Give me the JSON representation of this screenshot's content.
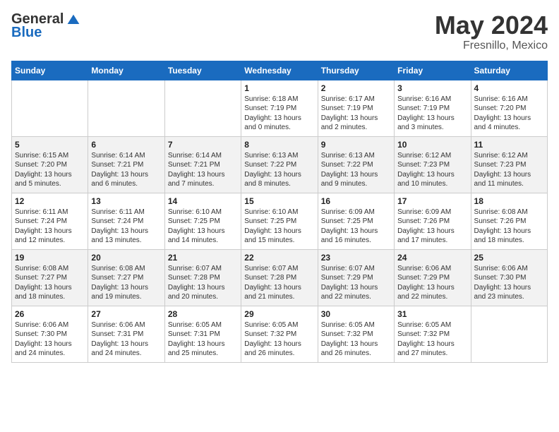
{
  "header": {
    "logo_general": "General",
    "logo_blue": "Blue",
    "month": "May 2024",
    "location": "Fresnillo, Mexico"
  },
  "days_of_week": [
    "Sunday",
    "Monday",
    "Tuesday",
    "Wednesday",
    "Thursday",
    "Friday",
    "Saturday"
  ],
  "weeks": [
    [
      {
        "day": "",
        "info": ""
      },
      {
        "day": "",
        "info": ""
      },
      {
        "day": "",
        "info": ""
      },
      {
        "day": "1",
        "info": "Sunrise: 6:18 AM\nSunset: 7:19 PM\nDaylight: 13 hours\nand 0 minutes."
      },
      {
        "day": "2",
        "info": "Sunrise: 6:17 AM\nSunset: 7:19 PM\nDaylight: 13 hours\nand 2 minutes."
      },
      {
        "day": "3",
        "info": "Sunrise: 6:16 AM\nSunset: 7:19 PM\nDaylight: 13 hours\nand 3 minutes."
      },
      {
        "day": "4",
        "info": "Sunrise: 6:16 AM\nSunset: 7:20 PM\nDaylight: 13 hours\nand 4 minutes."
      }
    ],
    [
      {
        "day": "5",
        "info": "Sunrise: 6:15 AM\nSunset: 7:20 PM\nDaylight: 13 hours\nand 5 minutes."
      },
      {
        "day": "6",
        "info": "Sunrise: 6:14 AM\nSunset: 7:21 PM\nDaylight: 13 hours\nand 6 minutes."
      },
      {
        "day": "7",
        "info": "Sunrise: 6:14 AM\nSunset: 7:21 PM\nDaylight: 13 hours\nand 7 minutes."
      },
      {
        "day": "8",
        "info": "Sunrise: 6:13 AM\nSunset: 7:22 PM\nDaylight: 13 hours\nand 8 minutes."
      },
      {
        "day": "9",
        "info": "Sunrise: 6:13 AM\nSunset: 7:22 PM\nDaylight: 13 hours\nand 9 minutes."
      },
      {
        "day": "10",
        "info": "Sunrise: 6:12 AM\nSunset: 7:23 PM\nDaylight: 13 hours\nand 10 minutes."
      },
      {
        "day": "11",
        "info": "Sunrise: 6:12 AM\nSunset: 7:23 PM\nDaylight: 13 hours\nand 11 minutes."
      }
    ],
    [
      {
        "day": "12",
        "info": "Sunrise: 6:11 AM\nSunset: 7:24 PM\nDaylight: 13 hours\nand 12 minutes."
      },
      {
        "day": "13",
        "info": "Sunrise: 6:11 AM\nSunset: 7:24 PM\nDaylight: 13 hours\nand 13 minutes."
      },
      {
        "day": "14",
        "info": "Sunrise: 6:10 AM\nSunset: 7:25 PM\nDaylight: 13 hours\nand 14 minutes."
      },
      {
        "day": "15",
        "info": "Sunrise: 6:10 AM\nSunset: 7:25 PM\nDaylight: 13 hours\nand 15 minutes."
      },
      {
        "day": "16",
        "info": "Sunrise: 6:09 AM\nSunset: 7:25 PM\nDaylight: 13 hours\nand 16 minutes."
      },
      {
        "day": "17",
        "info": "Sunrise: 6:09 AM\nSunset: 7:26 PM\nDaylight: 13 hours\nand 17 minutes."
      },
      {
        "day": "18",
        "info": "Sunrise: 6:08 AM\nSunset: 7:26 PM\nDaylight: 13 hours\nand 18 minutes."
      }
    ],
    [
      {
        "day": "19",
        "info": "Sunrise: 6:08 AM\nSunset: 7:27 PM\nDaylight: 13 hours\nand 18 minutes."
      },
      {
        "day": "20",
        "info": "Sunrise: 6:08 AM\nSunset: 7:27 PM\nDaylight: 13 hours\nand 19 minutes."
      },
      {
        "day": "21",
        "info": "Sunrise: 6:07 AM\nSunset: 7:28 PM\nDaylight: 13 hours\nand 20 minutes."
      },
      {
        "day": "22",
        "info": "Sunrise: 6:07 AM\nSunset: 7:28 PM\nDaylight: 13 hours\nand 21 minutes."
      },
      {
        "day": "23",
        "info": "Sunrise: 6:07 AM\nSunset: 7:29 PM\nDaylight: 13 hours\nand 22 minutes."
      },
      {
        "day": "24",
        "info": "Sunrise: 6:06 AM\nSunset: 7:29 PM\nDaylight: 13 hours\nand 22 minutes."
      },
      {
        "day": "25",
        "info": "Sunrise: 6:06 AM\nSunset: 7:30 PM\nDaylight: 13 hours\nand 23 minutes."
      }
    ],
    [
      {
        "day": "26",
        "info": "Sunrise: 6:06 AM\nSunset: 7:30 PM\nDaylight: 13 hours\nand 24 minutes."
      },
      {
        "day": "27",
        "info": "Sunrise: 6:06 AM\nSunset: 7:31 PM\nDaylight: 13 hours\nand 24 minutes."
      },
      {
        "day": "28",
        "info": "Sunrise: 6:05 AM\nSunset: 7:31 PM\nDaylight: 13 hours\nand 25 minutes."
      },
      {
        "day": "29",
        "info": "Sunrise: 6:05 AM\nSunset: 7:32 PM\nDaylight: 13 hours\nand 26 minutes."
      },
      {
        "day": "30",
        "info": "Sunrise: 6:05 AM\nSunset: 7:32 PM\nDaylight: 13 hours\nand 26 minutes."
      },
      {
        "day": "31",
        "info": "Sunrise: 6:05 AM\nSunset: 7:32 PM\nDaylight: 13 hours\nand 27 minutes."
      },
      {
        "day": "",
        "info": ""
      }
    ]
  ]
}
